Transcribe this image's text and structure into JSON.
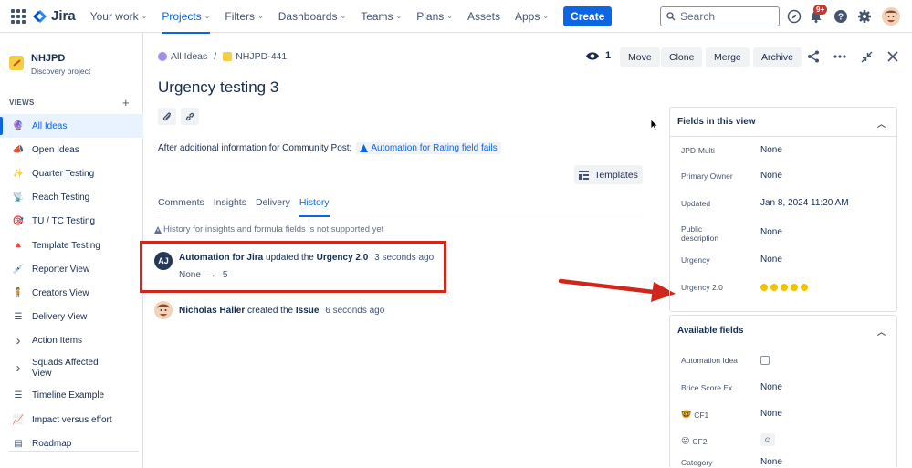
{
  "topnav": {
    "brand": "Jira",
    "items": [
      {
        "label": "Your work",
        "chevron": true
      },
      {
        "label": "Projects",
        "chevron": true,
        "active": true
      },
      {
        "label": "Filters",
        "chevron": true
      },
      {
        "label": "Dashboards",
        "chevron": true
      },
      {
        "label": "Teams",
        "chevron": true
      },
      {
        "label": "Plans",
        "chevron": true
      },
      {
        "label": "Assets",
        "chevron": false
      },
      {
        "label": "Apps",
        "chevron": true
      }
    ],
    "create_label": "Create",
    "search_placeholder": "Search",
    "notification_badge": "9+",
    "accent": "#0c66e4"
  },
  "project": {
    "name": "NHJPD",
    "type": "Discovery project"
  },
  "sidebar": {
    "views_header": "VIEWS",
    "items": [
      {
        "label": "All Ideas",
        "icon": "crystal-ball-icon",
        "glyph": "🔮",
        "active": true
      },
      {
        "label": "Open Ideas",
        "icon": "megaphone-icon",
        "glyph": "📣"
      },
      {
        "label": "Quarter Testing",
        "icon": "sparkle-icon",
        "glyph": "✨"
      },
      {
        "label": "Reach Testing",
        "icon": "satellite-icon",
        "glyph": "📡"
      },
      {
        "label": "TU / TC Testing",
        "icon": "target-icon",
        "glyph": "🎯"
      },
      {
        "label": "Template Testing",
        "icon": "cone-icon",
        "glyph": "🔺"
      },
      {
        "label": "Reporter View",
        "icon": "syringe-icon",
        "glyph": "💉"
      },
      {
        "label": "Creators View",
        "icon": "person-icon",
        "glyph": "🧍"
      },
      {
        "label": "Delivery View",
        "icon": "list-icon",
        "glyph": "☰"
      },
      {
        "label": "Action Items",
        "icon": "chevron-right-icon",
        "glyph": "›"
      },
      {
        "label": "Squads Affected View",
        "icon": "chevron-right-icon",
        "glyph": "›",
        "two_line": true
      },
      {
        "label": "Timeline Example",
        "icon": "timeline-icon",
        "glyph": "☰"
      },
      {
        "label": "Impact versus effort",
        "icon": "chart-icon",
        "glyph": "📈"
      },
      {
        "label": "Roadmap",
        "icon": "board-icon",
        "glyph": "▤"
      }
    ]
  },
  "breadcrumb": {
    "parent": "All Ideas",
    "issue_key": "NHJPD-441"
  },
  "toolbar": {
    "watch_count": "1",
    "move": "Move",
    "clone": "Clone",
    "merge": "Merge",
    "archive": "Archive"
  },
  "issue": {
    "title": "Urgency testing 3",
    "description_prefix": "After additional information for Community Post:",
    "linked_item": "Automation for Rating field fails",
    "templates_label": "Templates"
  },
  "tabs": [
    {
      "label": "Comments"
    },
    {
      "label": "Insights"
    },
    {
      "label": "Delivery"
    },
    {
      "label": "History",
      "active": true
    }
  ],
  "history": {
    "note": "History for insights and formula fields is not supported yet",
    "entries": [
      {
        "avatar": "AJ",
        "actor": "Automation for Jira",
        "verb": "updated the",
        "field": "Urgency 2.0",
        "time": "3 seconds ago",
        "from": "None",
        "to": "5"
      },
      {
        "actor": "Nicholas Haller",
        "verb": "created the",
        "field": "Issue",
        "time": "6 seconds ago"
      }
    ]
  },
  "fields_panel": {
    "title": "Fields in this view",
    "rows": [
      {
        "label": "JPD-Multi",
        "value": "None"
      },
      {
        "label": "Primary Owner",
        "value": "None"
      },
      {
        "label": "Updated",
        "value": "Jan 8, 2024 11:20 AM"
      },
      {
        "label": "Public description",
        "value": "None"
      },
      {
        "label": "Urgency",
        "value": "None"
      },
      {
        "label": "Urgency 2.0",
        "rating": 5
      }
    ]
  },
  "available_panel": {
    "title": "Available fields",
    "rows": [
      {
        "label": "Automation Idea",
        "checkbox": true
      },
      {
        "label": "Brice Score Ex.",
        "value": "None"
      },
      {
        "label": "CF1",
        "value": "None",
        "emoji": "🤓"
      },
      {
        "label": "CF2",
        "emoji": "😜",
        "add_emoji": true
      },
      {
        "label": "Category",
        "value": "None"
      }
    ]
  },
  "colors": {
    "highlight": "#d0271d",
    "rating_dot": "#f2c300"
  }
}
